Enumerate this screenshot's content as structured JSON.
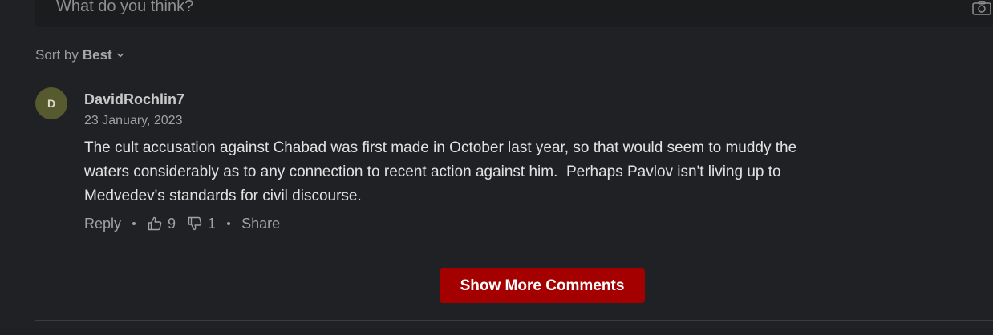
{
  "comment_box": {
    "placeholder": "What do you think?",
    "camera_icon": "camera-icon"
  },
  "sort": {
    "prefix": "Sort by",
    "value": "Best",
    "icon": "chevron-down-icon"
  },
  "comment": {
    "avatar_initial": "D",
    "avatar_color": "#575a2e",
    "username": "DavidRochlin7",
    "date": "23 January, 2023",
    "text": "The cult accusation against Chabad was first made in October last year, so that would seem to muddy the waters considerably as to any connection to recent action against him.  Perhaps Pavlov isn't living up to Medvedev's standards for civil discourse.",
    "actions": {
      "reply_label": "Reply",
      "likes": "9",
      "dislikes": "1",
      "share_label": "Share"
    }
  },
  "show_more": {
    "label": "Show More Comments",
    "color": "#a50000"
  }
}
